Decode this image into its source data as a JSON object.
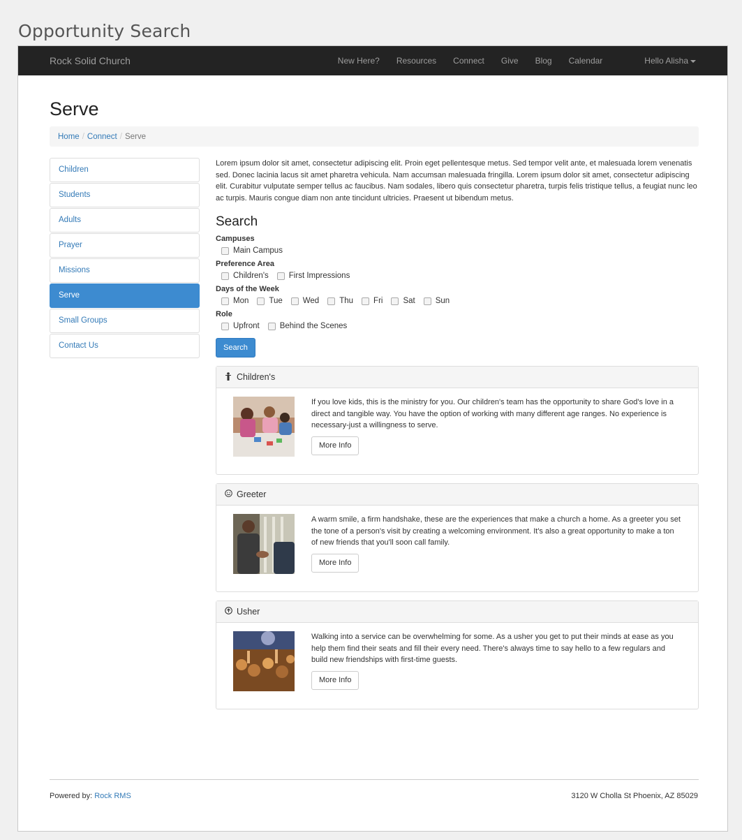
{
  "doc_title": "Opportunity Search",
  "navbar": {
    "brand": "Rock Solid Church",
    "links": [
      "New Here?",
      "Resources",
      "Connect",
      "Give",
      "Blog",
      "Calendar"
    ],
    "user": "Hello Alisha"
  },
  "page": {
    "title": "Serve",
    "breadcrumb": [
      "Home",
      "Connect",
      "Serve"
    ]
  },
  "sidebar": {
    "items": [
      {
        "label": "Children"
      },
      {
        "label": "Students"
      },
      {
        "label": "Adults"
      },
      {
        "label": "Prayer"
      },
      {
        "label": "Missions"
      },
      {
        "label": "Serve",
        "active": true
      },
      {
        "label": "Small Groups"
      },
      {
        "label": "Contact Us"
      }
    ]
  },
  "main": {
    "intro": "Lorem ipsum dolor sit amet, consectetur adipiscing elit. Proin eget pellentesque metus. Sed tempor velit ante, et malesuada lorem venenatis sed. Donec lacinia lacus sit amet pharetra vehicula. Nam accumsan malesuada fringilla. Lorem ipsum dolor sit amet, consectetur adipiscing elit. Curabitur vulputate semper tellus ac faucibus. Nam sodales, libero quis consectetur pharetra, turpis felis tristique tellus, a feugiat nunc leo ac turpis. Mauris congue diam non ante tincidunt ultricies. Praesent ut bibendum metus.",
    "search_heading": "Search",
    "filters": {
      "campuses": {
        "label": "Campuses",
        "options": [
          "Main Campus"
        ]
      },
      "preference": {
        "label": "Preference Area",
        "options": [
          "Children's",
          "First Impressions"
        ]
      },
      "days": {
        "label": "Days of the Week",
        "options": [
          "Mon",
          "Tue",
          "Wed",
          "Thu",
          "Fri",
          "Sat",
          "Sun"
        ]
      },
      "role": {
        "label": "Role",
        "options": [
          "Upfront",
          "Behind the Scenes"
        ]
      }
    },
    "search_button": "Search",
    "results": [
      {
        "title": "Children's",
        "icon": "child-icon",
        "description": "If you love kids, this is the ministry for you. Our children's team has the opportunity to share God's love in a direct and tangible way. You have the option of working with many different age ranges. No experience is necessary-just a willingness to serve.",
        "button": "More Info"
      },
      {
        "title": "Greeter",
        "icon": "smile-icon",
        "description": "A warm smile, a firm handshake, these are the experiences that make a church a home. As a greeter you set the tone of a person's visit by creating a welcoming environment. It's also a great opportunity to make a ton of new friends that you'll soon call family.",
        "button": "More Info"
      },
      {
        "title": "Usher",
        "icon": "circle-arrow-icon",
        "description": "Walking into a service can be overwhelming for some. As a usher you get to put their minds at ease as you help them find their seats and fill their every need. There's always time to say hello to a few regulars and build new friendships with first-time guests.",
        "button": "More Info"
      }
    ]
  },
  "footer": {
    "powered_label": "Powered by:",
    "powered_link": "Rock RMS",
    "address": "3120 W Cholla St Phoenix, AZ 85029"
  },
  "colors": {
    "navbar": "#232323",
    "primary": "#3d8bd0",
    "link": "#337ab7"
  }
}
